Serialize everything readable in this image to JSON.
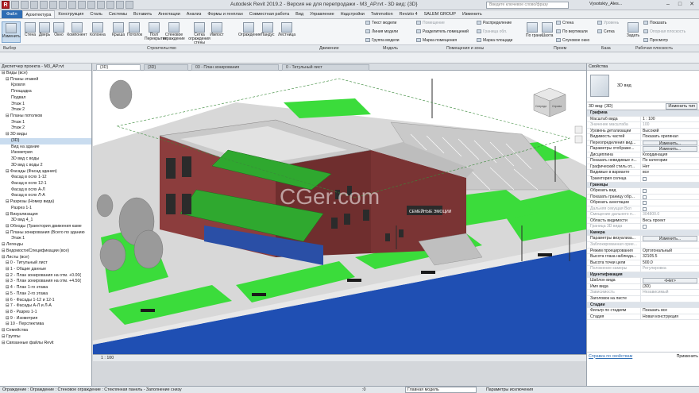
{
  "window": {
    "title": "Autodesk Revit 2019.2 - Версия не для перепродажи - M3_AP.rvt - 3D вид: {3D}",
    "search_placeholder": "Введите ключевое слово/фразу",
    "user": "Vysotskiy_Ales..."
  },
  "tabs": [
    "Файл",
    "Архитектура",
    "Конструкция",
    "Сталь",
    "Системы",
    "Вставить",
    "Аннотации",
    "Анализ",
    "Формы и генплан",
    "Совместная работа",
    "Вид",
    "Управление",
    "Надстройки",
    "Twinmotion",
    "Revizto 4",
    "SALEM GROUP",
    "Изменить"
  ],
  "ribbon": {
    "modify": "Изменить",
    "build": [
      "Стена",
      "Дверь",
      "Окно",
      "Компонент",
      "Колонна",
      "Крыша",
      "Потолок",
      "Пол/Перекрытие",
      "Стеновое ограждение",
      "Сетка ограждения стены",
      "Импост",
      "Ограждение",
      "Пандус",
      "Лестница"
    ],
    "model": [
      "Текст модели",
      "Линия модели",
      "Группа модели"
    ],
    "rooms": [
      "Помещение",
      "Разделитель помещений",
      "Марка помещения",
      "Зона",
      "Граница зон",
      "Марка зоны"
    ],
    "area": [
      "Распределение",
      "Граница обл.",
      "Марка площади"
    ],
    "opening": [
      "По грани",
      "Шахта",
      "Стена",
      "По вертикали",
      "Слуховое окно"
    ],
    "datum": [
      "Уровень",
      "Сетка"
    ],
    "workplane": [
      "Задать",
      "Показать",
      "Опорная плоскость",
      "Просмотр"
    ],
    "panels": [
      "Выбор",
      "Строительство",
      "Движение",
      "Модель",
      "Помещения и зоны",
      "Проем",
      "База",
      "Рабочая плоскость"
    ]
  },
  "project_browser": {
    "title": "Диспетчер проекта - M3_AP.rvt",
    "tree": [
      {
        "text": "Виды (все)",
        "lvl": 0
      },
      {
        "text": "Планы этажей",
        "lvl": 1
      },
      {
        "text": "Кровля",
        "lvl": 2
      },
      {
        "text": "Площадка",
        "lvl": 2
      },
      {
        "text": "Подвал",
        "lvl": 2
      },
      {
        "text": "Этаж 1",
        "lvl": 2
      },
      {
        "text": "Этаж 2",
        "lvl": 2
      },
      {
        "text": "Планы потолков",
        "lvl": 1
      },
      {
        "text": "Этаж 1",
        "lvl": 2
      },
      {
        "text": "Этаж 2",
        "lvl": 2
      },
      {
        "text": "3D виды",
        "lvl": 1
      },
      {
        "text": "{3D}",
        "lvl": 2,
        "sel": true
      },
      {
        "text": "Вид на здание",
        "lvl": 2
      },
      {
        "text": "Изометрия",
        "lvl": 2
      },
      {
        "text": "3D вид с воды",
        "lvl": 2
      },
      {
        "text": "3D вид с воды 2",
        "lvl": 2
      },
      {
        "text": "Фасады (Фасад здания)",
        "lvl": 1
      },
      {
        "text": "Фасад в осях 1-12",
        "lvl": 2
      },
      {
        "text": "Фасад в осях 12-1",
        "lvl": 2
      },
      {
        "text": "Фасад в осях А-Л",
        "lvl": 2
      },
      {
        "text": "Фасад в осях Л-А",
        "lvl": 2
      },
      {
        "text": "Разрезы (Номер вида)",
        "lvl": 1
      },
      {
        "text": "Разрез 1-1",
        "lvl": 2
      },
      {
        "text": "Визуализация",
        "lvl": 1
      },
      {
        "text": "3D вид 4_1",
        "lvl": 2
      },
      {
        "text": "Обходы (Траектория движения каме",
        "lvl": 1
      },
      {
        "text": "Планы зонирования (Всего по зданию",
        "lvl": 1
      },
      {
        "text": "Этаж 1",
        "lvl": 2
      },
      {
        "text": "Легенды",
        "lvl": 0
      },
      {
        "text": "Ведомости/Спецификации (все)",
        "lvl": 0
      },
      {
        "text": "Листы (все)",
        "lvl": 0
      },
      {
        "text": "0 - Титульный лист",
        "lvl": 1
      },
      {
        "text": "1 - Общие данные",
        "lvl": 1
      },
      {
        "text": "2 - План зонирования на отм. +0.00(",
        "lvl": 1
      },
      {
        "text": "3 - План зонирования на отм. +4.50(",
        "lvl": 1
      },
      {
        "text": "4 - План 1-го этажа",
        "lvl": 1
      },
      {
        "text": "5 - План 2-го этажа",
        "lvl": 1
      },
      {
        "text": "6 - Фасады 1-12 и 12-1",
        "lvl": 1
      },
      {
        "text": "7 - Фасады А-Л и Л-А",
        "lvl": 1
      },
      {
        "text": "8 - Разрез 1-1",
        "lvl": 1
      },
      {
        "text": "9 - Изометрия",
        "lvl": 1
      },
      {
        "text": "10 - Перспектива",
        "lvl": 1
      },
      {
        "text": "Семейства",
        "lvl": 0
      },
      {
        "text": "Группы",
        "lvl": 0
      },
      {
        "text": "Связанные файлы Revit",
        "lvl": 0
      }
    ]
  },
  "view_tabs": [
    "{3D}",
    "{3D}",
    "03 - План зонирования",
    "0 - Титульный лист"
  ],
  "viewport": {
    "watermark": "CGer.com",
    "sign": "СЕМЕЙНЫЕ ЭМОЦИИ",
    "viewcube_front": "Спереди",
    "viewcube_right": "Справа"
  },
  "view_control": {
    "scale": "1 : 100"
  },
  "properties": {
    "title": "Свойства",
    "type_name": "3D вид",
    "view_selector": "3D вид: {3D}",
    "edit_type": "Изменить тип",
    "rows": [
      {
        "g": "Графика"
      },
      {
        "k": "Масштаб вида",
        "v": "1 : 100"
      },
      {
        "k": "Значение масштаба",
        "v": "100",
        "dis": true
      },
      {
        "k": "Уровень детализации",
        "v": "Высокий"
      },
      {
        "k": "Видимость частей",
        "v": "Показать оригинал"
      },
      {
        "k": "Переопределения вид...",
        "btn": "Изменить..."
      },
      {
        "k": "Параметры отображе...",
        "btn": "Изменить..."
      },
      {
        "k": "Дисциплина",
        "v": "Координация"
      },
      {
        "k": "Показать невидимые л...",
        "v": "По категории"
      },
      {
        "k": "Графический стиль от...",
        "v": "Нет"
      },
      {
        "k": "Видимые в варианте",
        "v": "все"
      },
      {
        "k": "Траектория солнца",
        "cb": false
      },
      {
        "g": "Границы"
      },
      {
        "k": "Обрезать вид",
        "cb": false
      },
      {
        "k": "Показать границу обр...",
        "cb": false
      },
      {
        "k": "Обрезать аннотации",
        "cb": false
      },
      {
        "k": "Дальняя секущая Вкл",
        "cb": false,
        "dis": true
      },
      {
        "k": "Смещение дальнего п...",
        "v": "304800.0",
        "dis": true
      },
      {
        "k": "Область видимости",
        "v": "Весь проект"
      },
      {
        "k": "Граница 3D вида",
        "cb": false,
        "dis": true
      },
      {
        "g": "Камера"
      },
      {
        "k": "Параметры визуализа...",
        "btn": "Изменить..."
      },
      {
        "k": "Заблокированная орие...",
        "v": "",
        "dis": true
      },
      {
        "k": "Режим проецирования",
        "v": "Ортогональный"
      },
      {
        "k": "Высота глаза наблюда...",
        "v": "32105.5"
      },
      {
        "k": "Высота точки цели",
        "v": "500.0"
      },
      {
        "k": "Положение камеры",
        "v": "Регулировка",
        "dis": true
      },
      {
        "g": "Идентификация"
      },
      {
        "k": "Шаблон вида",
        "btn": "<Нет>"
      },
      {
        "k": "Имя вида",
        "v": "{3D}"
      },
      {
        "k": "Зависимость",
        "v": "Независимый",
        "dis": true
      },
      {
        "k": "Заголовок на листе",
        "v": ""
      },
      {
        "g": "Стадии"
      },
      {
        "k": "Фильтр по стадиям",
        "v": "Показать все"
      },
      {
        "k": "Стадия",
        "v": "Новая конструкция"
      }
    ],
    "help_link": "Справка по свойствам",
    "apply": "Применить"
  },
  "status": {
    "text": "Ограждение : Ограждение : Стеновое ограждение : Стеклянная панель - Заполнение снизу",
    "model": "Главная модель",
    "exclusion": "Параметры исключения",
    "zero": ":0"
  }
}
